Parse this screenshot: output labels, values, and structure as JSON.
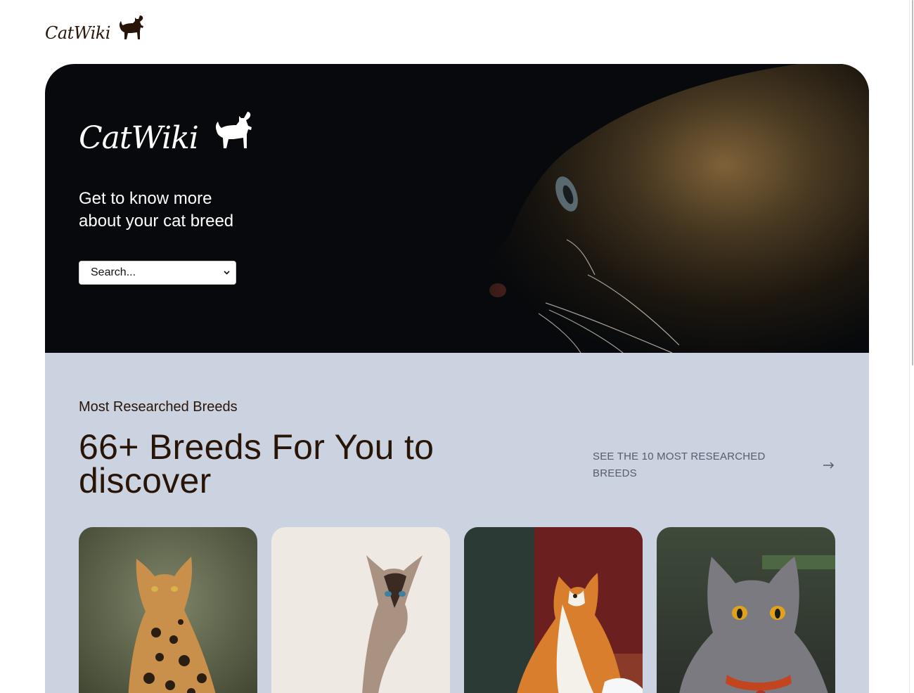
{
  "header": {
    "logo_text": "CatWiki"
  },
  "hero": {
    "logo_text": "CatWiki",
    "tagline": "Get to know more about your cat breed",
    "search": {
      "selected": "Search..."
    }
  },
  "breeds_section": {
    "label": "Most Researched Breeds",
    "headline": "66+ Breeds For You to discover",
    "see_more": "SEE THE 10 MOST RESEARCHED BREEDS",
    "cards": [
      {
        "icon": "savannah-cat-photo"
      },
      {
        "icon": "siamese-cat-photo"
      },
      {
        "icon": "calico-longhair-cat-photo"
      },
      {
        "icon": "british-shorthair-cat-photo"
      }
    ]
  },
  "colors": {
    "brand_dark": "#291507",
    "section_bg": "#cbd3e0",
    "hero_bg": "#07090c",
    "link_gray": "#5b5a6e"
  }
}
